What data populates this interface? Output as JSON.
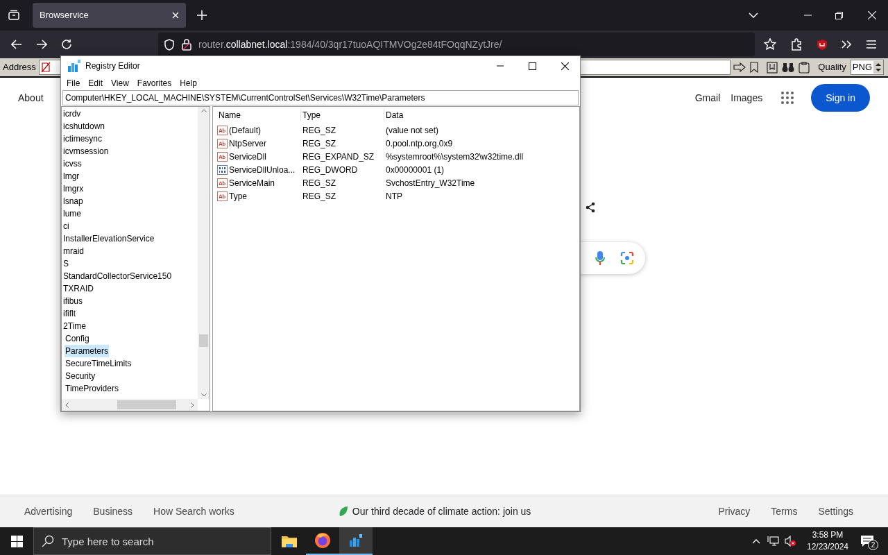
{
  "browser": {
    "tabs": [
      {
        "title": "Browservice",
        "selected": true
      }
    ],
    "url": {
      "prefix": "router.",
      "domain": "collabnet.local",
      "path": ":1984/40/3qr17tuoAQITMVOg2e84tFOqqNZytJre/"
    }
  },
  "addon_toolbar": {
    "address_label": "Address",
    "quality_label": "Quality",
    "format": "PNG"
  },
  "page": {
    "top_left_links": [
      "About"
    ],
    "top_right_links": [
      "Gmail",
      "Images"
    ],
    "sign_in": "Sign in",
    "footer_left": [
      "Advertising",
      "Business",
      "How Search works"
    ],
    "climate": "Our third decade of climate action: join us",
    "footer_right": [
      "Privacy",
      "Terms",
      "Settings"
    ]
  },
  "registry": {
    "title": "Registry Editor",
    "menu": [
      "File",
      "Edit",
      "View",
      "Favorites",
      "Help"
    ],
    "path": "Computer\\HKEY_LOCAL_MACHINE\\SYSTEM\\CurrentControlSet\\Services\\W32Time\\Parameters",
    "tree": [
      {
        "label": "icrdv",
        "selected": false
      },
      {
        "label": "icshutdown",
        "selected": false
      },
      {
        "label": "ictimesync",
        "selected": false
      },
      {
        "label": "icvmsession",
        "selected": false
      },
      {
        "label": "icvss",
        "selected": false
      },
      {
        "label": "lmgr",
        "selected": false
      },
      {
        "label": "lmgrx",
        "selected": false
      },
      {
        "label": "lsnap",
        "selected": false
      },
      {
        "label": "lume",
        "selected": false
      },
      {
        "label": "ci",
        "selected": false
      },
      {
        "label": "InstallerElevationService",
        "selected": false
      },
      {
        "label": "mraid",
        "selected": false
      },
      {
        "label": "S",
        "selected": false
      },
      {
        "label": "StandardCollectorService150",
        "selected": false
      },
      {
        "label": "TXRAID",
        "selected": false
      },
      {
        "label": "ifibus",
        "selected": false
      },
      {
        "label": "ififlt",
        "selected": false
      },
      {
        "label": "2Time",
        "selected": false,
        "children": [
          {
            "label": "Config",
            "selected": false
          },
          {
            "label": "Parameters",
            "selected": true
          },
          {
            "label": "SecureTimeLimits",
            "selected": false
          },
          {
            "label": "Security",
            "selected": false
          },
          {
            "label": "TimeProviders",
            "selected": false
          }
        ]
      }
    ],
    "columns": [
      "Name",
      "Type",
      "Data"
    ],
    "values": [
      {
        "kind": "string",
        "name": "(Default)",
        "type": "REG_SZ",
        "data": "(value not set)"
      },
      {
        "kind": "string",
        "name": "NtpServer",
        "type": "REG_SZ",
        "data": "0.pool.ntp.org,0x9"
      },
      {
        "kind": "string",
        "name": "ServiceDll",
        "type": "REG_EXPAND_SZ",
        "data": "%systemroot%\\system32\\w32time.dll"
      },
      {
        "kind": "binary",
        "name": "ServiceDllUnloa...",
        "type": "REG_DWORD",
        "data": "0x00000001 (1)"
      },
      {
        "kind": "string",
        "name": "ServiceMain",
        "type": "REG_SZ",
        "data": "SvchostEntry_W32Time"
      },
      {
        "kind": "string",
        "name": "Type",
        "type": "REG_SZ",
        "data": "NTP"
      }
    ]
  },
  "taskbar": {
    "search_placeholder": "Type here to search",
    "apps": [
      {
        "kind": "folder",
        "running": false,
        "selected": false
      },
      {
        "kind": "firefox",
        "running": true,
        "selected": false
      },
      {
        "kind": "regedit",
        "running": true,
        "selected": true
      }
    ],
    "time": "3:58 PM",
    "date": "12/23/2024",
    "notifications": "2"
  }
}
